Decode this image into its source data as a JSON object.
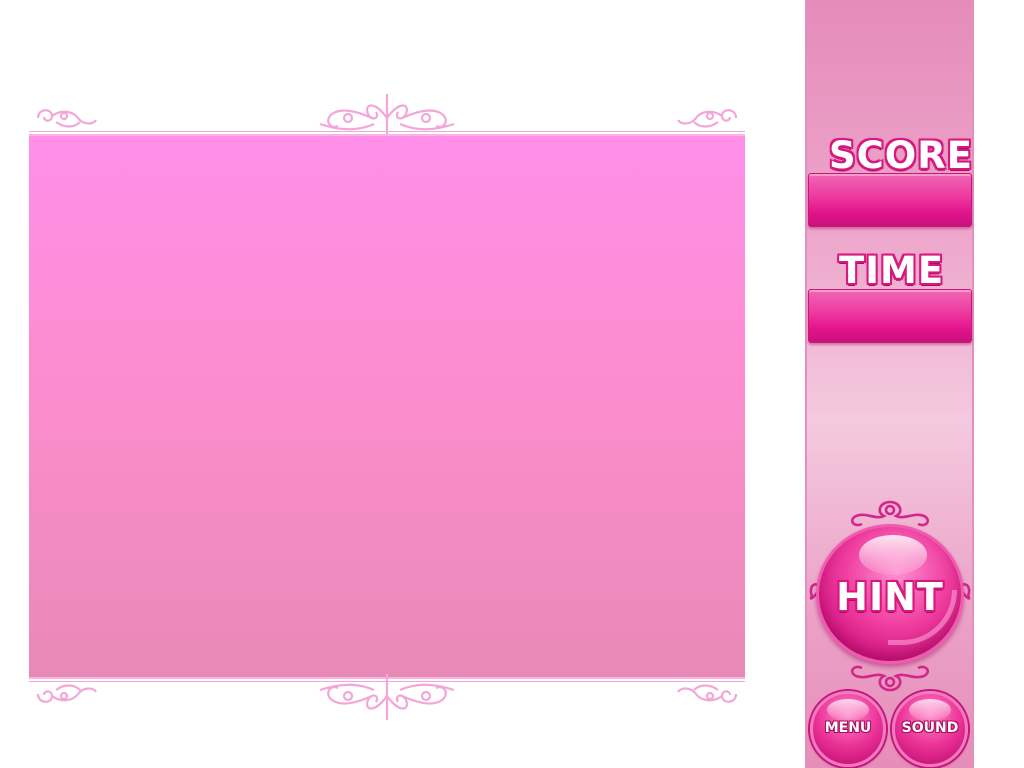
{
  "hud": {
    "score_label": "SCORE",
    "score_value": "",
    "time_label": "TIME",
    "time_value": ""
  },
  "buttons": {
    "hint_label": "HINT",
    "menu_label": "MENU",
    "sound_label": "SOUND"
  },
  "icons": {
    "top_left": "swirl-ornament-icon",
    "top_center": "fleur-ornament-icon",
    "top_right": "swirl-ornament-icon",
    "bottom_left": "swirl-ornament-icon",
    "bottom_center": "fleur-ornament-icon",
    "bottom_right": "swirl-ornament-icon",
    "hint_frame": "filigree-ornament-icon"
  },
  "colors": {
    "board_top": "#ff8fe9",
    "board_bottom": "#e88ab6",
    "accent": "#e2138c",
    "outline": "#d8177f"
  }
}
